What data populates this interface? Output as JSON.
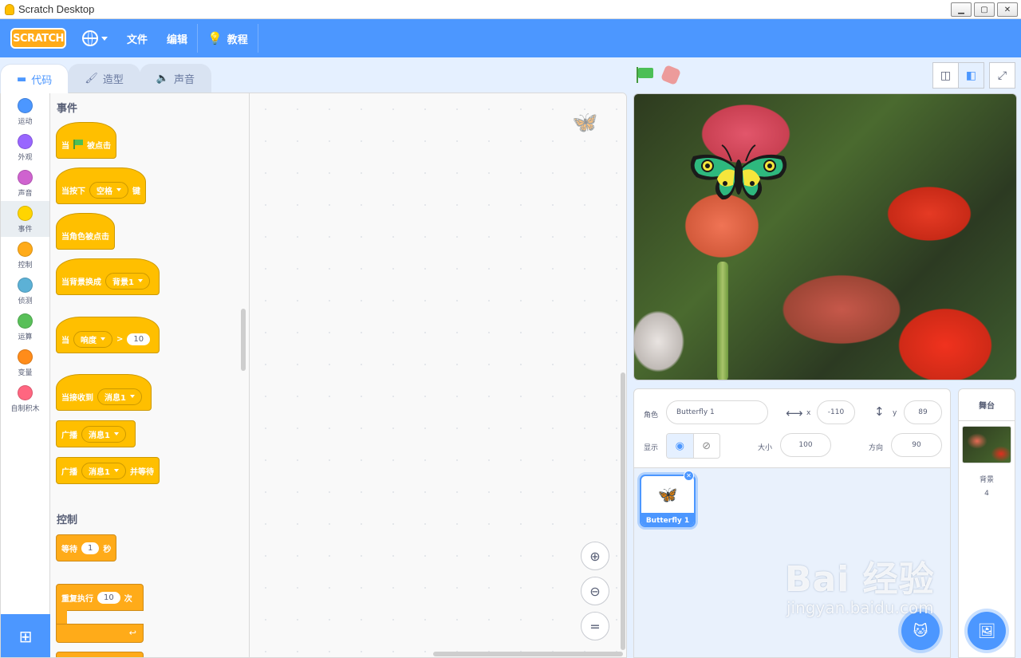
{
  "window": {
    "title": "Scratch Desktop"
  },
  "menubar": {
    "logo": "SCRATCH",
    "file": "文件",
    "edit": "编辑",
    "tutorials": "教程"
  },
  "tabs": [
    {
      "label": "代码",
      "icon": "code-icon"
    },
    {
      "label": "造型",
      "icon": "brush-icon"
    },
    {
      "label": "声音",
      "icon": "speaker-icon"
    }
  ],
  "categories": [
    {
      "label": "运动",
      "color": "#4c97ff"
    },
    {
      "label": "外观",
      "color": "#9966ff"
    },
    {
      "label": "声音",
      "color": "#cf63cf"
    },
    {
      "label": "事件",
      "color": "#ffd500"
    },
    {
      "label": "控制",
      "color": "#ffab19"
    },
    {
      "label": "侦测",
      "color": "#5cb1d6"
    },
    {
      "label": "运算",
      "color": "#59c059"
    },
    {
      "label": "变量",
      "color": "#ff8c1a"
    },
    {
      "label": "自制积木",
      "color": "#ff6680"
    }
  ],
  "palette": {
    "events_heading": "事件",
    "control_heading": "控制",
    "blocks": {
      "when_flag_pre": "当",
      "when_flag_post": "被点击",
      "when_key_pre": "当按下",
      "when_key_field": "空格",
      "when_key_post": "键",
      "when_sprite_clicked": "当角色被点击",
      "when_backdrop_pre": "当背景换成",
      "when_backdrop_field": "背景1",
      "when_gt_pre": "当",
      "when_gt_field": "响度",
      "when_gt_op": ">",
      "when_gt_value": "10",
      "when_receive_pre": "当接收到",
      "when_receive_field": "消息1",
      "broadcast_pre": "广播",
      "broadcast_field": "消息1",
      "broadcast_wait_pre": "广播",
      "broadcast_wait_field": "消息1",
      "broadcast_wait_post": "并等待",
      "wait_pre": "等待",
      "wait_value": "1",
      "wait_post": "秒",
      "repeat_pre": "重复执行",
      "repeat_value": "10",
      "repeat_post": "次"
    }
  },
  "sprite_info": {
    "sprite_label": "角色",
    "sprite_name": "Butterfly 1",
    "x_label": "x",
    "x_value": "-110",
    "y_label": "y",
    "y_value": "89",
    "show_label": "显示",
    "size_label": "大小",
    "size_value": "100",
    "direction_label": "方向",
    "direction_value": "90"
  },
  "sprites": [
    {
      "name": "Butterfly 1"
    }
  ],
  "stage_panel": {
    "title": "舞台",
    "backdrops_label": "背景",
    "backdrops_count": "4"
  },
  "watermark": {
    "line1": "Bai 经验",
    "line2": "jingyan.baidu.com"
  }
}
